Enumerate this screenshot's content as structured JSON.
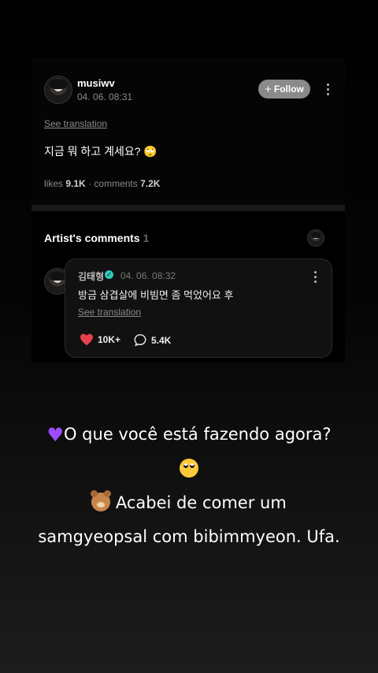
{
  "post": {
    "username": "musiwv",
    "date": "04. 06. 08:31",
    "follow_label": "Follow",
    "see_translation": "See translation",
    "text": "지금 뭐 하고 계세요? 🙄",
    "likes_label": "likes",
    "likes_count": "9.1K",
    "comments_label": "comments",
    "comments_count": "7.2K"
  },
  "artist_comments": {
    "title": "Artist's comments",
    "count": "1",
    "comment": {
      "author": "김태형",
      "date": "04. 06. 08:32",
      "text": "방금 삼겹살에 비빔면 좀 먹었어요 후",
      "see_translation": "See translation",
      "likes": "10K+",
      "replies": "5.4K"
    }
  },
  "caption": {
    "line1": "O que você está fazendo agora?",
    "line3": "Acabei de comer um",
    "line4": "samgyeopsal com bibimmyeon. Ufa."
  },
  "colors": {
    "heart": "#e8414d",
    "verified": "#2fc7b6",
    "purple_heart": "#9b4dff"
  },
  "icons": [
    "plus-icon",
    "kebab-icon",
    "verified-icon",
    "heart-icon",
    "comment-bubble-icon",
    "purple-heart-emoji",
    "eye-roll-emoji",
    "bear-emoji"
  ]
}
